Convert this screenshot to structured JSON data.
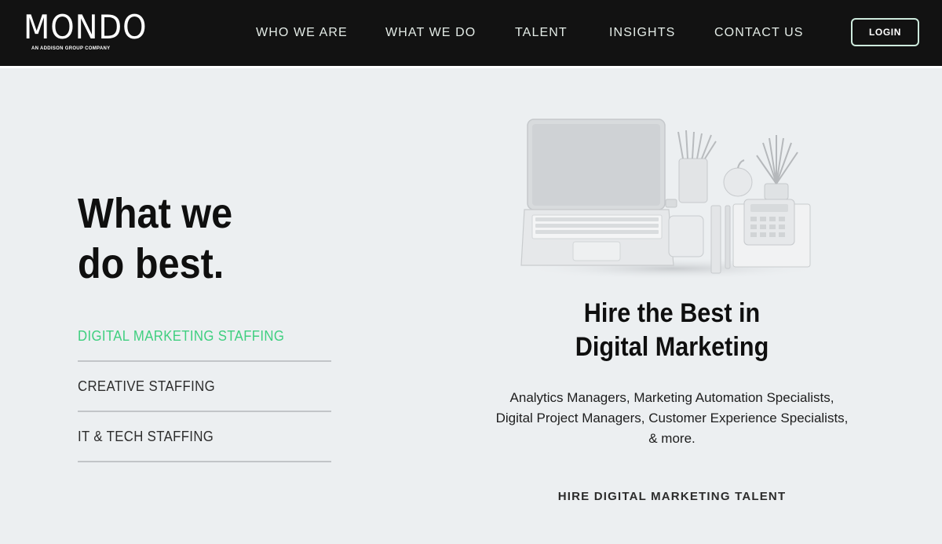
{
  "brand": {
    "name": "MONDO",
    "tagline": "AN ADDISON GROUP COMPANY"
  },
  "nav": {
    "items": [
      {
        "label": "WHO WE ARE"
      },
      {
        "label": "WHAT WE DO"
      },
      {
        "label": "TALENT"
      },
      {
        "label": "INSIGHTS"
      },
      {
        "label": "CONTACT US"
      }
    ],
    "login_label": "LOGIN"
  },
  "main": {
    "headline_line1": "What we",
    "headline_line2": "do best.",
    "services": [
      {
        "label": "DIGITAL MARKETING STAFFING",
        "active": true
      },
      {
        "label": "CREATIVE STAFFING",
        "active": false
      },
      {
        "label": "IT & TECH STAFFING",
        "active": false
      }
    ],
    "feature": {
      "title_line1": "Hire the Best in",
      "title_line2": "Digital Marketing",
      "description_line1": "Analytics Managers, Marketing Automation Specialists,",
      "description_line2": "Digital Project Managers, Customer Experience Specialists,",
      "description_line3": "& more.",
      "cta_label": "HIRE DIGITAL MARKETING TALENT"
    }
  },
  "colors": {
    "header_bg": "#121212",
    "page_bg": "#eceff1",
    "accent_green": "#3fcf7f",
    "divider": "#c2c5c8"
  }
}
